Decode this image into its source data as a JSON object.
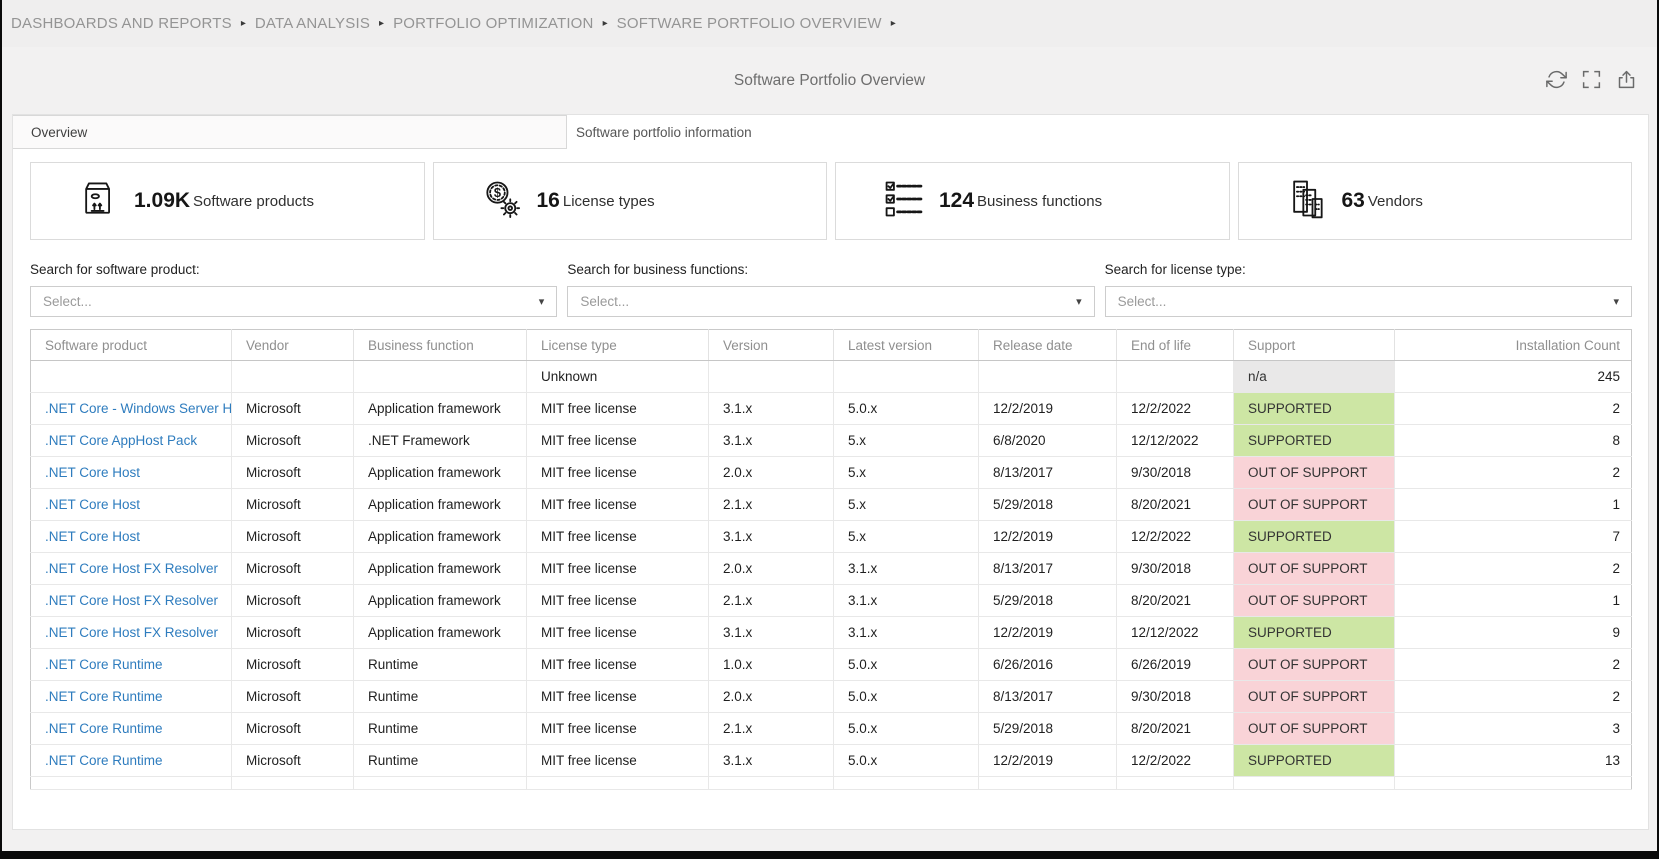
{
  "breadcrumb": {
    "separator": "▸",
    "items": [
      {
        "label": "DASHBOARDS AND REPORTS"
      },
      {
        "label": "DATA ANALYSIS"
      },
      {
        "label": "PORTFOLIO OPTIMIZATION"
      },
      {
        "label": "SOFTWARE PORTFOLIO OVERVIEW"
      }
    ]
  },
  "header": {
    "title": "Software Portfolio Overview",
    "icons": [
      "refresh-icon",
      "fullscreen-icon",
      "export-icon"
    ]
  },
  "tabs": [
    {
      "label": "Overview",
      "active": false
    },
    {
      "label": "Software portfolio information",
      "active": true
    }
  ],
  "kpis": [
    {
      "icon": "package-icon",
      "value": "1.09K",
      "label": "Software products"
    },
    {
      "icon": "dollar-gear-icon",
      "value": "16",
      "label": "License types"
    },
    {
      "icon": "checklist-icon",
      "value": "124",
      "label": "Business functions"
    },
    {
      "icon": "buildings-icon",
      "value": "63",
      "label": "Vendors"
    }
  ],
  "filters": [
    {
      "label": "Search for software product:",
      "placeholder": "Select..."
    },
    {
      "label": "Search for business functions:",
      "placeholder": "Select..."
    },
    {
      "label": "Search for license type:",
      "placeholder": "Select..."
    }
  ],
  "table": {
    "columns": [
      "Software product",
      "Vendor",
      "Business function",
      "License type",
      "Version",
      "Latest version",
      "Release date",
      "End of life",
      "Support",
      "Installation Count"
    ],
    "rows": [
      {
        "product": "",
        "vendor": "",
        "business_function": "",
        "license_type": "Unknown",
        "version": "",
        "latest_version": "",
        "release_date": "",
        "end_of_life": "",
        "support": "n/a",
        "support_status": "na",
        "installs": "245",
        "row_style": ""
      },
      {
        "product": ".NET Core - Windows Server H...",
        "vendor": "Microsoft",
        "business_function": "Application framework",
        "license_type": "MIT free license",
        "version": "3.1.x",
        "latest_version": "5.0.x",
        "release_date": "12/2/2019",
        "end_of_life": "12/2/2022",
        "support": "SUPPORTED",
        "support_status": "supported",
        "installs": "2",
        "row_style": ""
      },
      {
        "product": ".NET Core AppHost Pack",
        "vendor": "Microsoft",
        "business_function": ".NET Framework",
        "license_type": "MIT free license",
        "version": "3.1.x",
        "latest_version": "5.x",
        "release_date": "6/8/2020",
        "end_of_life": "12/12/2022",
        "support": "SUPPORTED",
        "support_status": "supported",
        "installs": "8",
        "row_style": ""
      },
      {
        "product": ".NET Core Host",
        "vendor": "Microsoft",
        "business_function": "Application framework",
        "license_type": "MIT free license",
        "version": "2.0.x",
        "latest_version": "5.x",
        "release_date": "8/13/2017",
        "end_of_life": "9/30/2018",
        "support": "OUT OF SUPPORT",
        "support_status": "out",
        "installs": "2",
        "row_style": ""
      },
      {
        "product": ".NET Core Host",
        "vendor": "Microsoft",
        "business_function": "Application framework",
        "license_type": "MIT free license",
        "version": "2.1.x",
        "latest_version": "5.x",
        "release_date": "5/29/2018",
        "end_of_life": "8/20/2021",
        "support": "OUT OF SUPPORT",
        "support_status": "out",
        "installs": "1",
        "row_style": ""
      },
      {
        "product": ".NET Core Host",
        "vendor": "Microsoft",
        "business_function": "Application framework",
        "license_type": "MIT free license",
        "version": "3.1.x",
        "latest_version": "5.x",
        "release_date": "12/2/2019",
        "end_of_life": "12/2/2022",
        "support": "SUPPORTED",
        "support_status": "supported",
        "installs": "7",
        "row_style": ""
      },
      {
        "product": ".NET Core Host FX Resolver",
        "vendor": "Microsoft",
        "business_function": "Application framework",
        "license_type": "MIT free license",
        "version": "2.0.x",
        "latest_version": "3.1.x",
        "release_date": "8/13/2017",
        "end_of_life": "9/30/2018",
        "support": "OUT OF SUPPORT",
        "support_status": "out",
        "installs": "2",
        "row_style": ""
      },
      {
        "product": ".NET Core Host FX Resolver",
        "vendor": "Microsoft",
        "business_function": "Application framework",
        "license_type": "MIT free license",
        "version": "2.1.x",
        "latest_version": "3.1.x",
        "release_date": "5/29/2018",
        "end_of_life": "8/20/2021",
        "support": "OUT OF SUPPORT",
        "support_status": "out",
        "installs": "1",
        "row_style": ""
      },
      {
        "product": ".NET Core Host FX Resolver",
        "vendor": "Microsoft",
        "business_function": "Application framework",
        "license_type": "MIT free license",
        "version": "3.1.x",
        "latest_version": "3.1.x",
        "release_date": "12/2/2019",
        "end_of_life": "12/12/2022",
        "support": "SUPPORTED",
        "support_status": "supported",
        "installs": "9",
        "row_style": ""
      },
      {
        "product": ".NET Core Runtime",
        "vendor": "Microsoft",
        "business_function": "Runtime",
        "license_type": "MIT free license",
        "version": "1.0.x",
        "latest_version": "5.0.x",
        "release_date": "6/26/2016",
        "end_of_life": "6/26/2019",
        "support": "OUT OF SUPPORT",
        "support_status": "out",
        "installs": "2",
        "row_style": ""
      },
      {
        "product": ".NET Core Runtime",
        "vendor": "Microsoft",
        "business_function": "Runtime",
        "license_type": "MIT free license",
        "version": "2.0.x",
        "latest_version": "5.0.x",
        "release_date": "8/13/2017",
        "end_of_life": "9/30/2018",
        "support": "OUT OF SUPPORT",
        "support_status": "out",
        "installs": "2",
        "row_style": ""
      },
      {
        "product": ".NET Core Runtime",
        "vendor": "Microsoft",
        "business_function": "Runtime",
        "license_type": "MIT free license",
        "version": "2.1.x",
        "latest_version": "5.0.x",
        "release_date": "5/29/2018",
        "end_of_life": "8/20/2021",
        "support": "OUT OF SUPPORT",
        "support_status": "out",
        "installs": "3",
        "row_style": ""
      },
      {
        "product": ".NET Core Runtime",
        "vendor": "Microsoft",
        "business_function": "Runtime",
        "license_type": "MIT free license",
        "version": "3.1.x",
        "latest_version": "5.0.x",
        "release_date": "12/2/2019",
        "end_of_life": "12/2/2022",
        "support": "SUPPORTED",
        "support_status": "supported",
        "installs": "13",
        "row_style": ""
      },
      {
        "product": "",
        "vendor": "",
        "business_function": "",
        "license_type": "",
        "version": "",
        "latest_version": "",
        "release_date": "",
        "end_of_life": "",
        "support": "",
        "support_status": "",
        "installs": "",
        "row_style": "partial"
      }
    ]
  },
  "colors": {
    "link": "#2e7cbe",
    "supported_bg": "#cde6a4",
    "out_of_support_bg": "#f9d3d7",
    "na_bg": "#e9e8e8",
    "page_bg": "#f2f1f1"
  }
}
